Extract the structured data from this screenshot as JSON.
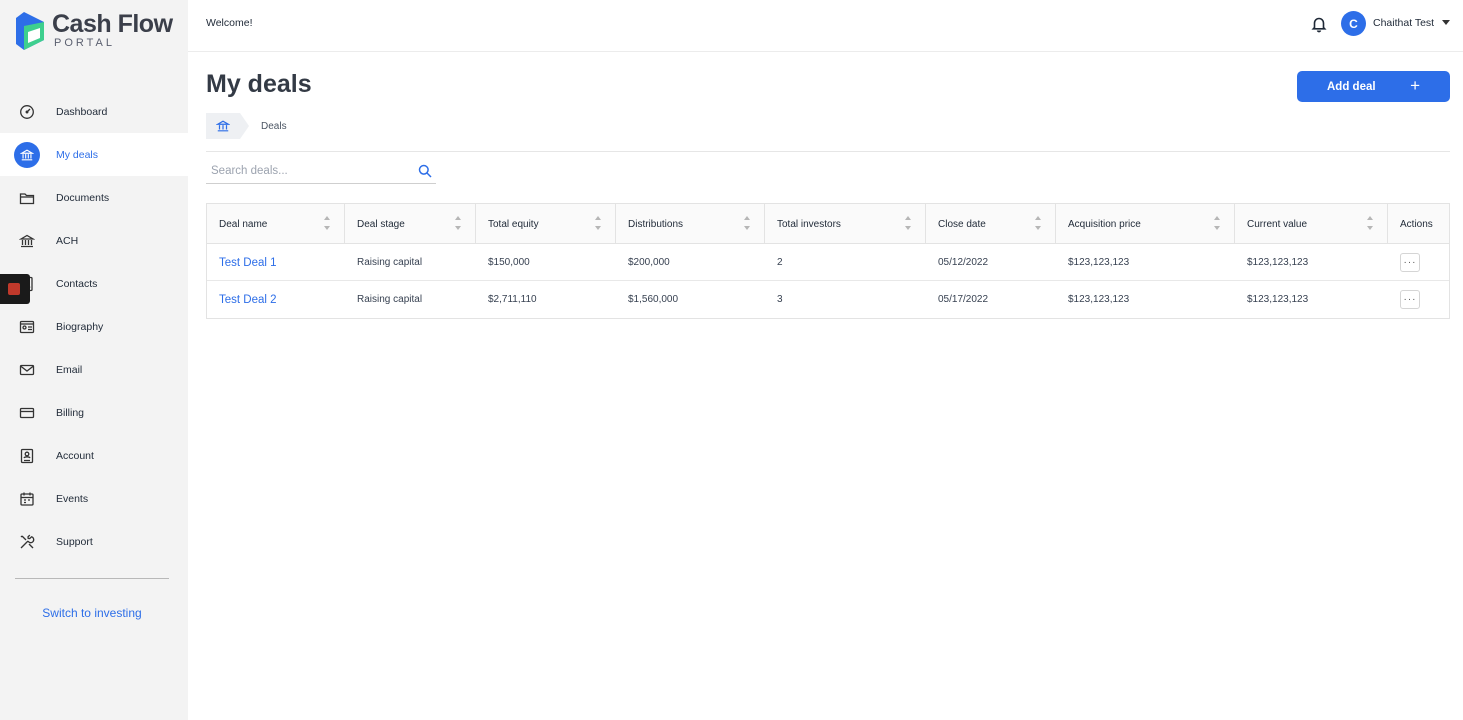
{
  "brand": {
    "title": "Cash Flow",
    "subtitle": "PORTAL",
    "colors": {
      "accent": "#2d6ee8",
      "logo_blue": "#2d6ee8",
      "logo_green": "#3ecf8e"
    }
  },
  "sidebar": {
    "items": [
      {
        "label": "Dashboard",
        "icon": "dashboard-gauge-icon",
        "active": false
      },
      {
        "label": "My deals",
        "icon": "bank-icon",
        "active": true
      },
      {
        "label": "Documents",
        "icon": "folder-icon",
        "active": false
      },
      {
        "label": "ACH",
        "icon": "bank-building-icon",
        "active": false
      },
      {
        "label": "Contacts",
        "icon": "contacts-book-icon",
        "active": false
      },
      {
        "label": "Biography",
        "icon": "profile-card-icon",
        "active": false
      },
      {
        "label": "Email",
        "icon": "envelope-icon",
        "active": false
      },
      {
        "label": "Billing",
        "icon": "credit-card-icon",
        "active": false
      },
      {
        "label": "Account",
        "icon": "account-document-icon",
        "active": false
      },
      {
        "label": "Events",
        "icon": "calendar-icon",
        "active": false
      },
      {
        "label": "Support",
        "icon": "tools-icon",
        "active": false
      }
    ],
    "switch_label": "Switch to investing"
  },
  "header": {
    "welcome": "Welcome!",
    "user": {
      "initial": "C",
      "name": "Chaithat Test"
    }
  },
  "main": {
    "title": "My deals",
    "add_button": "Add deal",
    "breadcrumb": {
      "current": "Deals"
    },
    "search": {
      "placeholder": "Search deals...",
      "value": ""
    },
    "table": {
      "columns": [
        "Deal name",
        "Deal stage",
        "Total equity",
        "Distributions",
        "Total investors",
        "Close date",
        "Acquisition price",
        "Current value",
        "Actions"
      ],
      "rows": [
        {
          "name": "Test Deal 1",
          "stage": "Raising capital",
          "equity": "$150,000",
          "distributions": "$200,000",
          "investors": "2",
          "close_date": "05/12/2022",
          "acquisition": "$123,123,123",
          "current": "$123,123,123",
          "actions": "···"
        },
        {
          "name": "Test Deal 2",
          "stage": "Raising capital",
          "equity": "$2,711,110",
          "distributions": "$1,560,000",
          "investors": "3",
          "close_date": "05/17/2022",
          "acquisition": "$123,123,123",
          "current": "$123,123,123",
          "actions": "···"
        }
      ]
    }
  }
}
